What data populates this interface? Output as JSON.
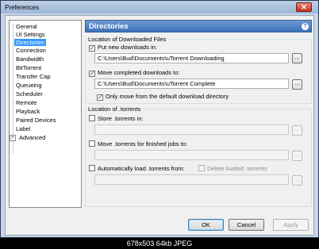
{
  "window": {
    "title": "Preferences",
    "ghost_title": "· · · · · ·  · · · ·  · · ·  · · · · · · · ·",
    "close": "✕"
  },
  "tree": {
    "items": [
      {
        "label": "General",
        "selected": false
      },
      {
        "label": "UI Settings",
        "selected": false
      },
      {
        "label": "Directories",
        "selected": true
      },
      {
        "label": "Connection",
        "selected": false
      },
      {
        "label": "Bandwidth",
        "selected": false
      },
      {
        "label": "BitTorrent",
        "selected": false
      },
      {
        "label": "Transfer Cap",
        "selected": false
      },
      {
        "label": "Queueing",
        "selected": false
      },
      {
        "label": "Scheduler",
        "selected": false
      },
      {
        "label": "Remote",
        "selected": false
      },
      {
        "label": "Playback",
        "selected": false
      },
      {
        "label": "Paired Devices",
        "selected": false
      },
      {
        "label": "Label",
        "selected": false
      },
      {
        "label": "Advanced",
        "selected": false,
        "expandable": true,
        "expander": "+"
      }
    ]
  },
  "panel": {
    "title": "Directories",
    "help": "?",
    "downloaded": {
      "group_title": "Location of Downloaded Files",
      "put_new": {
        "label": "Put new downloads in:",
        "checked": true,
        "path": "C:\\Users\\Bud\\Documents\\uTorrent Downloading"
      },
      "move_completed": {
        "label": "Move completed downloads to:",
        "checked": true,
        "path": "C:\\Users\\Bud\\Documents\\uTorrent Complete"
      },
      "only_default": {
        "label": "Only move from the default download directory",
        "checked": true
      }
    },
    "torrents": {
      "group_title": "Location of .torrents",
      "store": {
        "label": "Store .torrents in:",
        "checked": false,
        "path": ""
      },
      "move_finished": {
        "label": "Move .torrents for finished jobs to:",
        "checked": false,
        "path": ""
      },
      "auto_load": {
        "label": "Automatically load .torrents from:",
        "checked": false,
        "path": ""
      },
      "delete_loaded": {
        "label": "Delete loaded .torrents",
        "checked": false
      }
    },
    "browse": "..."
  },
  "buttons": {
    "ok": "OK",
    "cancel": "Cancel",
    "apply": "Apply"
  },
  "caption": "678x503  64kb  JPEG"
}
